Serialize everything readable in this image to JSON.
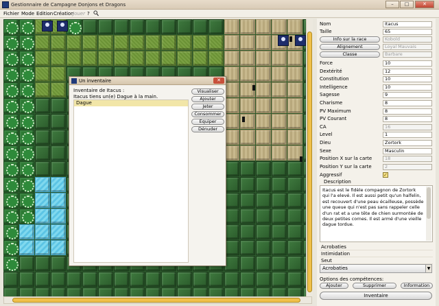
{
  "window": {
    "title": "Gestionnaire de Campagne Donjons et Dragons",
    "minimize": "–",
    "maximize": "□",
    "close": "✕"
  },
  "menu": {
    "items": [
      "Fichier",
      "Mode",
      "Edition",
      "Création",
      "Jouer",
      "?"
    ],
    "disabled_item": "Jouer",
    "search_icon": "search-icon"
  },
  "dialog": {
    "title": "Un inventaire",
    "close": "✕",
    "heading": "Inventaire de Itacus :",
    "subheading": "Itacus tiens un(e) Dague à la main.",
    "items": [
      "Dague"
    ],
    "buttons": [
      "Visualiser",
      "Ajouter",
      "Jeter",
      "Consommer",
      "Equiper",
      "Dénuder"
    ]
  },
  "character": {
    "nom_label": "Nom",
    "nom": "Itacus",
    "taille_label": "Taille",
    "taille": "65",
    "race_button": "Info sur la race",
    "race": "Kobold",
    "alignement_button": "Alignement",
    "alignement": "Loyal Mauvais",
    "classe_button": "Classe",
    "classe": "Barbare",
    "stats": [
      {
        "label": "Force",
        "value": "10"
      },
      {
        "label": "Dextérité",
        "value": "12"
      },
      {
        "label": "Constitution",
        "value": "10"
      },
      {
        "label": "Intelligence",
        "value": "10"
      },
      {
        "label": "Sagesse",
        "value": "9"
      },
      {
        "label": "Charisme",
        "value": "8"
      },
      {
        "label": "PV Maximum",
        "value": "8"
      },
      {
        "label": "PV Courant",
        "value": "8"
      },
      {
        "label": "CA",
        "value": "16"
      },
      {
        "label": "Level",
        "value": "1"
      },
      {
        "label": "Dieu",
        "value": "Zortork"
      },
      {
        "label": "Sexe",
        "value": "Masculin"
      },
      {
        "label": "Position X sur la carte",
        "value": "18"
      },
      {
        "label": "Position Y sur la carte",
        "value": "2"
      }
    ],
    "aggressif_label": "Aggressif",
    "aggressif_check": "✓",
    "description_label": "Description",
    "description": "Itacus est le fidèle compagnon de Zortork qui l'a elevé. Il est aussi petit qu'un halfelin, est recouvert d'une peau écailleuse, possède une queue qui n'est pas sans rappeler celle d'un rat et a une tête de chien surmontée de deux petites cornes. Il est armé d'une vieille dague tordue.",
    "skills": [
      "Acrobaties",
      "Intimidation",
      "Seut"
    ],
    "skill_select": "Acrobaties",
    "options_label": "Options des compétences:",
    "option_buttons": [
      "Ajouter",
      "Supprimer",
      "Information"
    ],
    "inventory_button": "Inventaire"
  }
}
